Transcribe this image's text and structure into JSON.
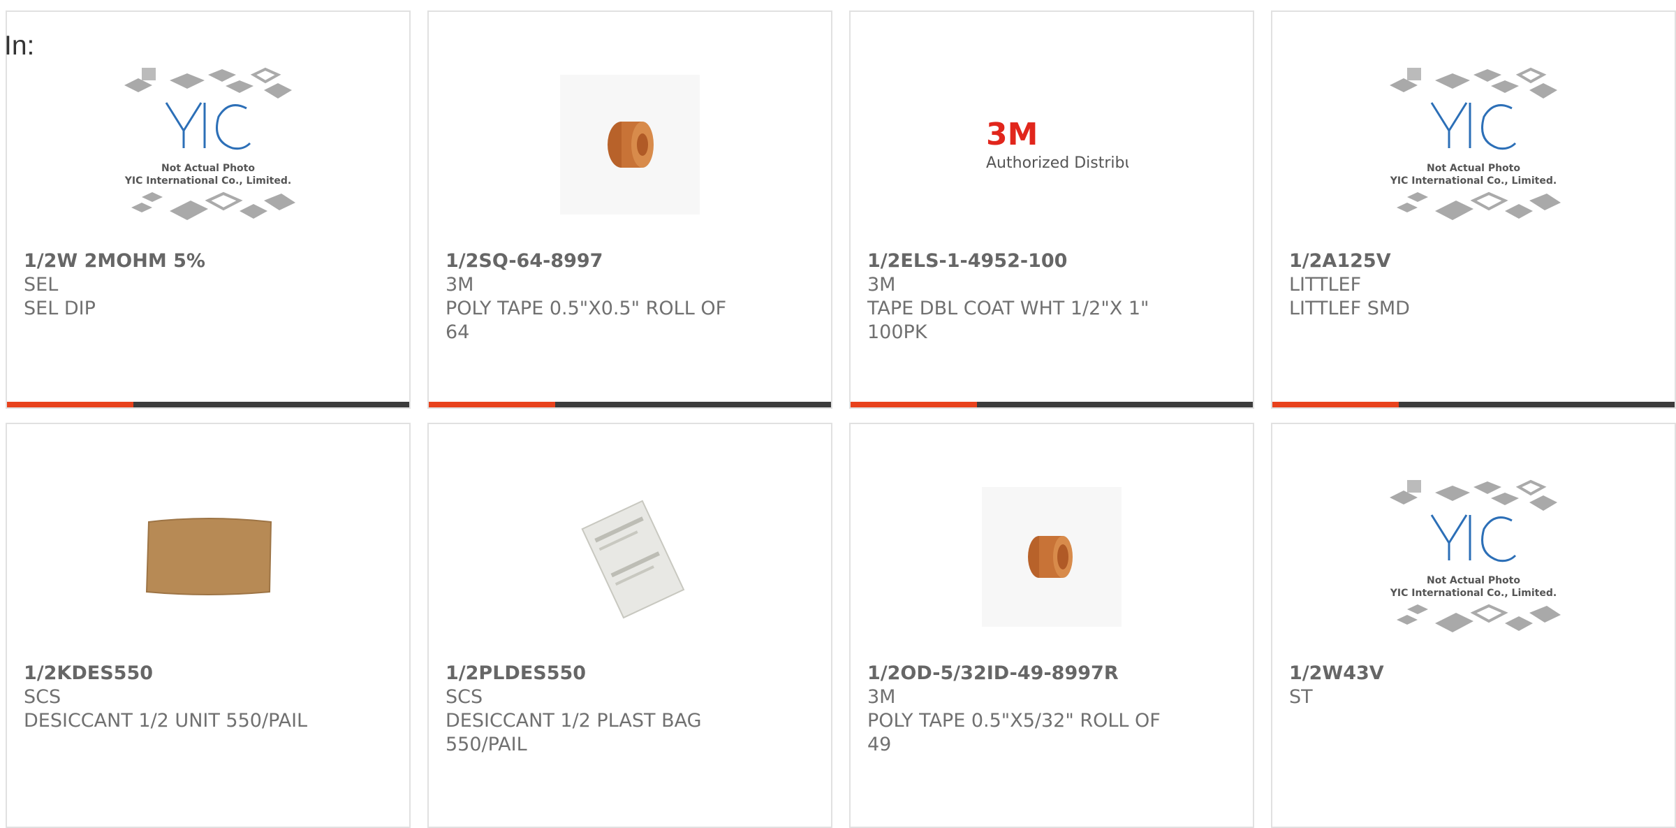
{
  "header": {
    "label": "In:"
  },
  "colors": {
    "accent": "#e8421d",
    "bar": "#3c3c3c",
    "text": "#6b6b6b"
  },
  "products": [
    {
      "part": "1/2W 2MOHM 5%",
      "mfr": "SEL",
      "desc": "SEL DIP",
      "image": "placeholder-photo"
    },
    {
      "part": "1/2SQ-64-8997",
      "mfr": "3M",
      "desc": "POLY TAPE 0.5\"X0.5\" ROLL OF 64",
      "image": "copper-tape-roll"
    },
    {
      "part": "1/2ELS-1-4952-100",
      "mfr": "3M",
      "desc": "TAPE DBL COAT WHT 1/2\"X 1\" 100PK",
      "image": "3m-logo"
    },
    {
      "part": "1/2A125V",
      "mfr": "LITTLEF",
      "desc": "LITTLEF SMD",
      "image": "placeholder-photo"
    },
    {
      "part": "1/2KDES550",
      "mfr": "SCS",
      "desc": "DESICCANT 1/2 UNIT 550/PAIL",
      "image": "desiccant-bag"
    },
    {
      "part": "1/2PLDES550",
      "mfr": "SCS",
      "desc": "DESICCANT 1/2 PLAST BAG 550/PAIL",
      "image": "desiccant-packet"
    },
    {
      "part": "1/2OD-5/32ID-49-8997R",
      "mfr": "3M",
      "desc": "POLY TAPE 0.5\"X5/32\" ROLL OF 49",
      "image": "copper-tape-roll"
    },
    {
      "part": "1/2W43V",
      "mfr": "ST",
      "desc": "",
      "image": "placeholder-photo"
    }
  ],
  "placeholder": {
    "line1": "Not Actual Photo",
    "line2": "YIC International Co., Limited.",
    "logo": "YIC"
  },
  "brand3m": {
    "logo": "3M",
    "tagline": "Authorized Distributor"
  }
}
